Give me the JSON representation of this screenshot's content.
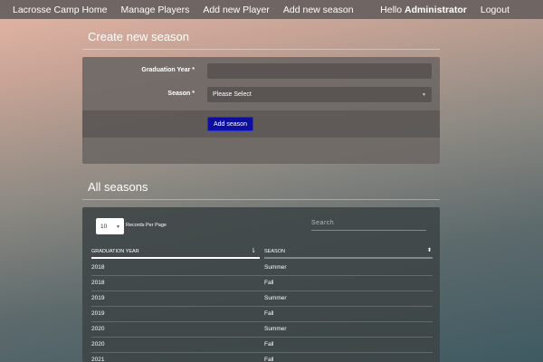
{
  "nav": {
    "home": "Lacrosse Camp Home",
    "manage_players": "Manage Players",
    "add_player": "Add new Player",
    "add_season": "Add new season",
    "hello": "Hello",
    "user": "Administrator",
    "logout": "Logout"
  },
  "create": {
    "title": "Create new season",
    "graduation_label": "Graduation Year *",
    "graduation_value": "",
    "season_label": "Season *",
    "season_selected": "Please Select",
    "add_button": "Add season"
  },
  "all": {
    "title": "All seasons",
    "records_per_page": "10",
    "records_label": "Records Per Page",
    "search_placeholder": "Search",
    "columns": [
      "GRADUATION YEAR",
      "SEASON"
    ],
    "rows": [
      [
        "2018",
        "Summer"
      ],
      [
        "2018",
        "Fall"
      ],
      [
        "2019",
        "Summer"
      ],
      [
        "2019",
        "Fall"
      ],
      [
        "2020",
        "Summer"
      ],
      [
        "2020",
        "Fall"
      ],
      [
        "2021",
        "Fall"
      ]
    ]
  },
  "colors": {
    "navbar": "#6f6562",
    "add_button": "#0b0e9e"
  }
}
